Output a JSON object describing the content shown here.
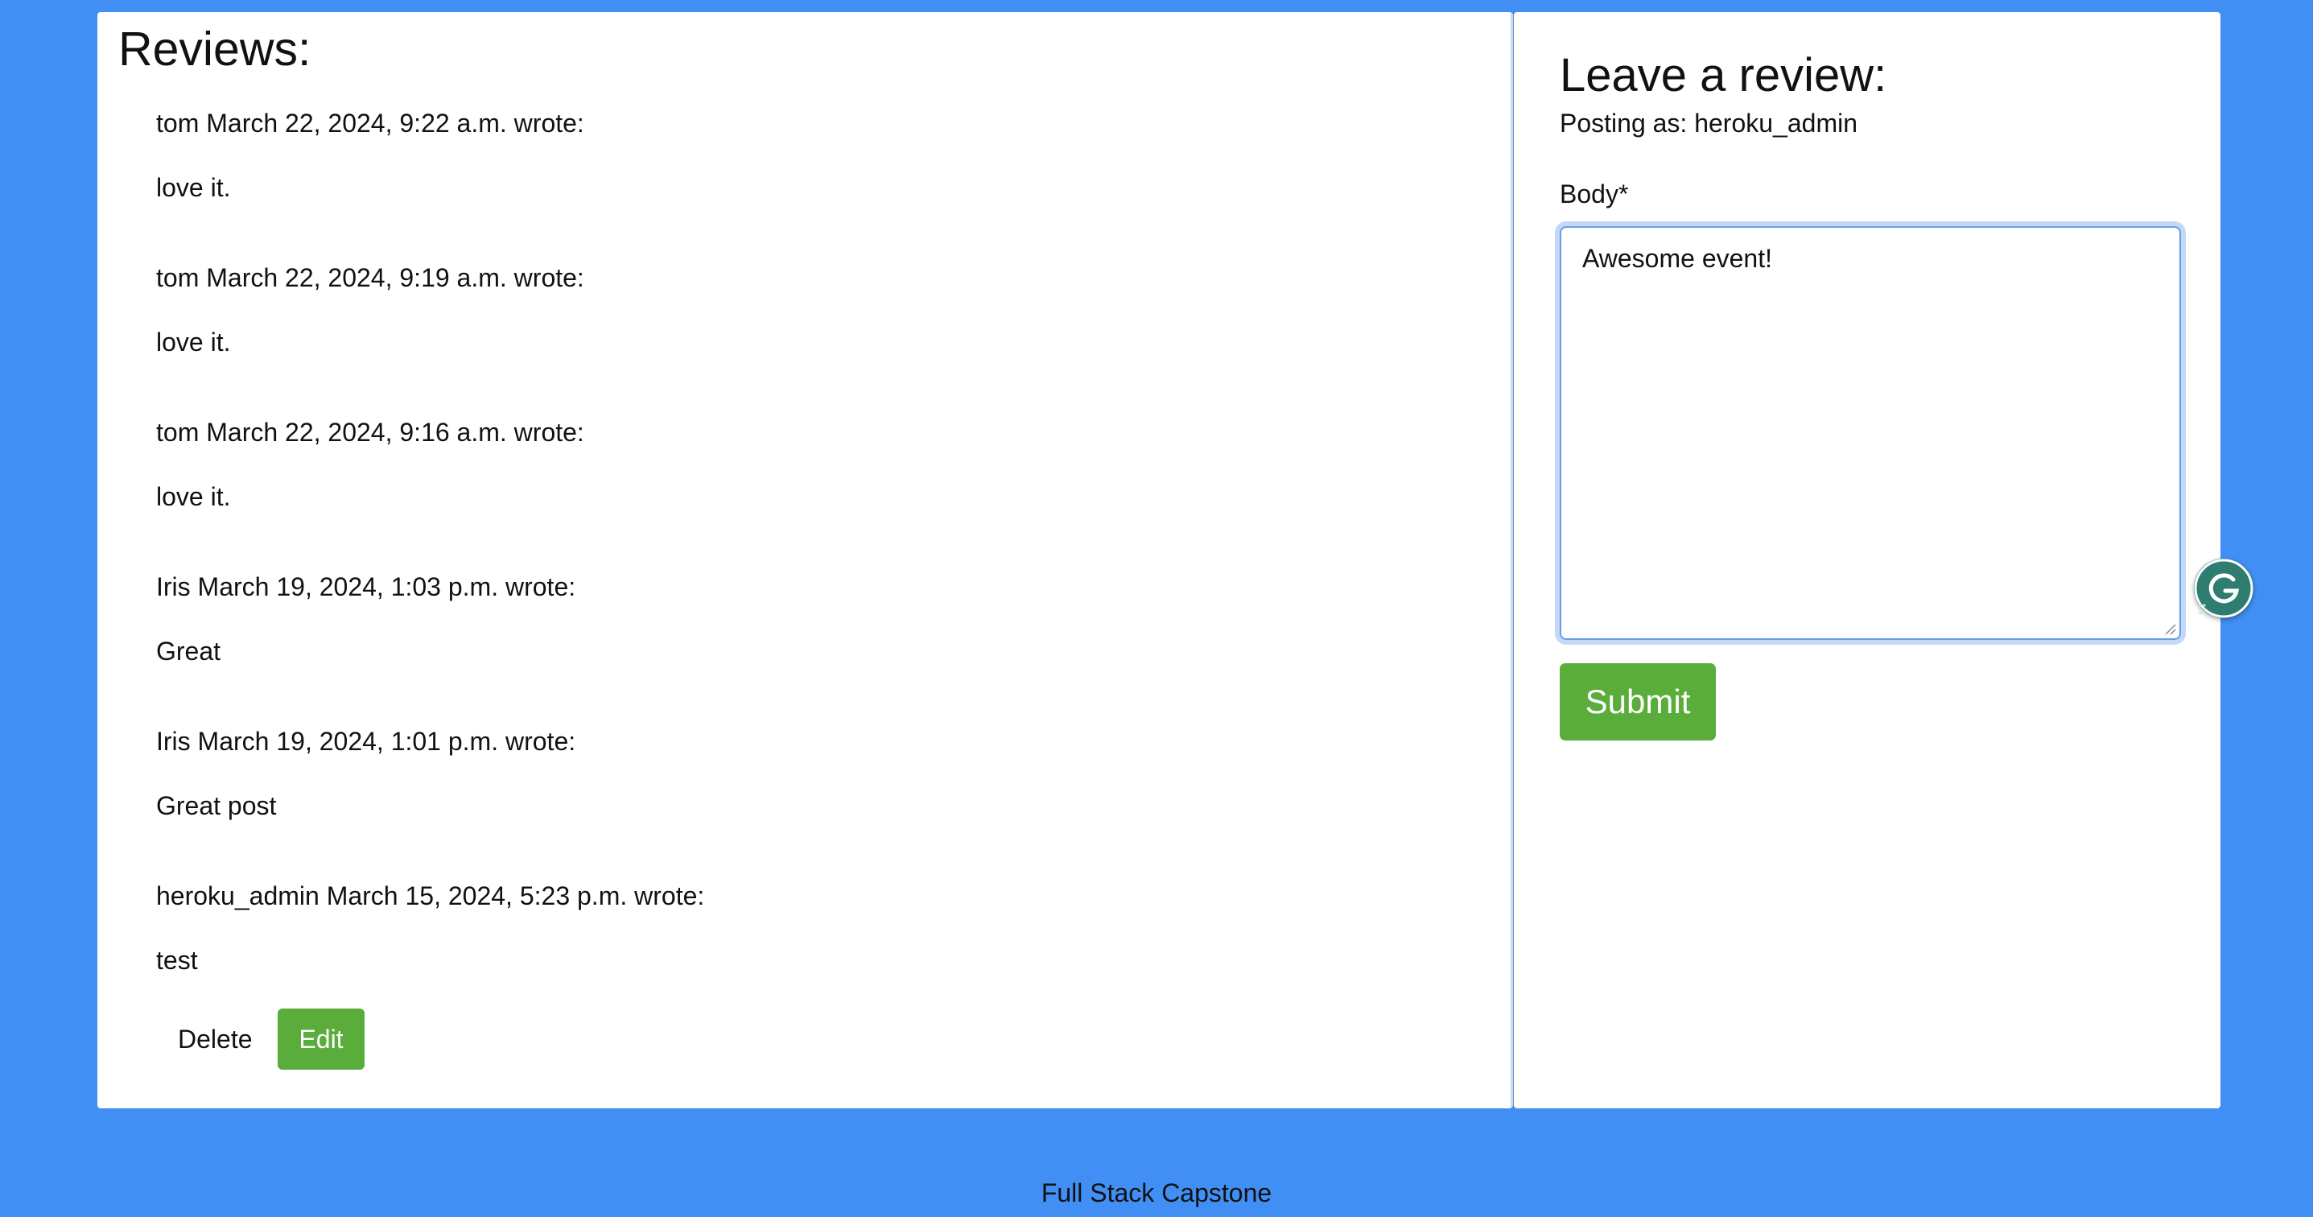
{
  "reviews_section": {
    "title": "Reviews:",
    "items": [
      {
        "meta": "tom March 22, 2024, 9:22 a.m. wrote:",
        "body": "love it."
      },
      {
        "meta": "tom March 22, 2024, 9:19 a.m. wrote:",
        "body": "love it."
      },
      {
        "meta": "tom March 22, 2024, 9:16 a.m. wrote:",
        "body": "love it."
      },
      {
        "meta": "Iris March 19, 2024, 1:03 p.m. wrote:",
        "body": "Great"
      },
      {
        "meta": "Iris March 19, 2024, 1:01 p.m. wrote:",
        "body": "Great post"
      },
      {
        "meta": "heroku_admin March 15, 2024, 5:23 p.m. wrote:",
        "body": "test"
      }
    ],
    "actions": {
      "delete_label": "Delete",
      "edit_label": "Edit"
    }
  },
  "review_form": {
    "title": "Leave a review:",
    "posting_as": "Posting as: heroku_admin",
    "body_label": "Body*",
    "body_value": "Awesome event!",
    "submit_label": "Submit"
  },
  "grammarly": {
    "icon": "grammarly-icon"
  },
  "footer": {
    "text": "Full Stack Capstone"
  },
  "colors": {
    "page_background": "#418ff5",
    "accent_green": "#5aac3b",
    "panel_background": "#ffffff",
    "focus_ring": "#c4d9f8",
    "grammarly_teal": "#2e7d70"
  }
}
